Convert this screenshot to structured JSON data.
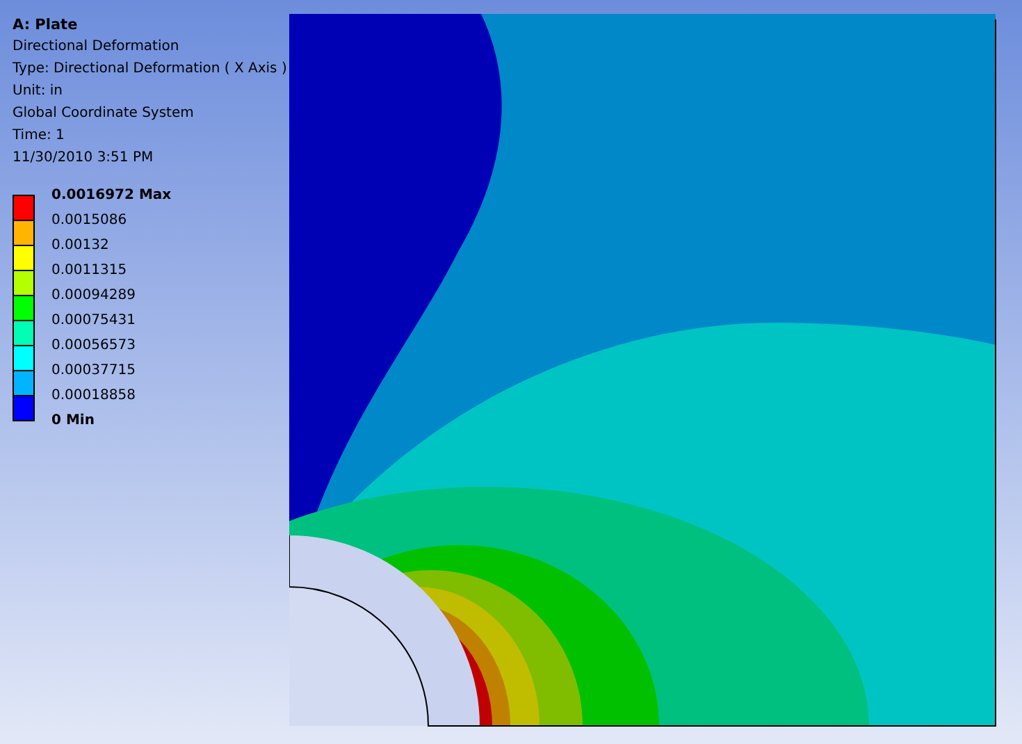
{
  "header": {
    "title": "A: Plate",
    "lines": [
      "Directional Deformation",
      "Type: Directional Deformation ( X Axis )",
      "Unit: in",
      "Global Coordinate System",
      "Time: 1",
      "11/30/2010 3:51 PM"
    ]
  },
  "legend": {
    "bands": [
      {
        "kind": "max",
        "label": "0.0016972 Max",
        "color": "#ff0000"
      },
      {
        "kind": "value",
        "label": "0.0015086",
        "color": "#ffb400"
      },
      {
        "kind": "value",
        "label": "0.00132",
        "color": "#ffff00"
      },
      {
        "kind": "value",
        "label": "0.0011315",
        "color": "#b4ff00"
      },
      {
        "kind": "value",
        "label": "0.00094289",
        "color": "#00ff00"
      },
      {
        "kind": "value",
        "label": "0.00075431",
        "color": "#00ffb4"
      },
      {
        "kind": "value",
        "label": "0.00056573",
        "color": "#00ffff"
      },
      {
        "kind": "value",
        "label": "0.00037715",
        "color": "#00b4ff"
      },
      {
        "kind": "value",
        "label": "0.00018858",
        "color": "#0000ff"
      }
    ],
    "min_label": "0 Min"
  }
}
